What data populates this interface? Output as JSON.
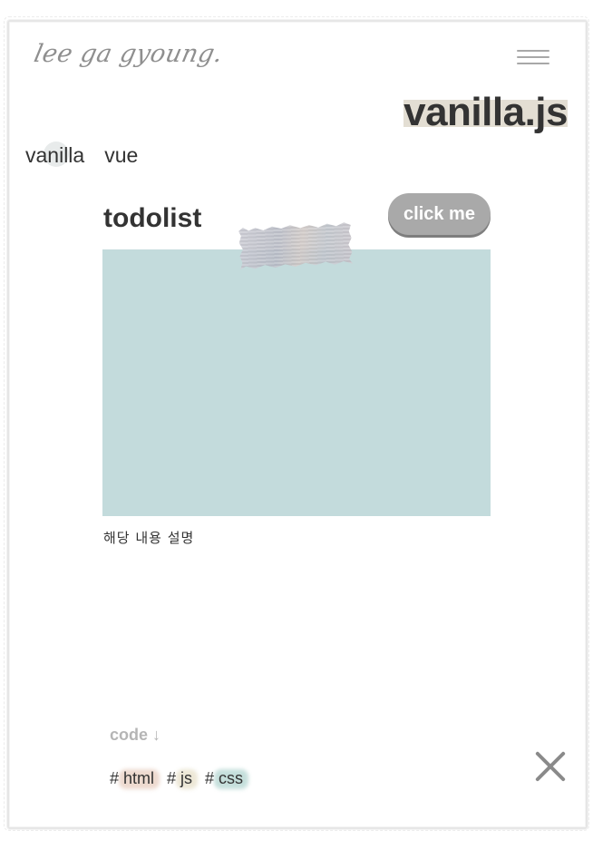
{
  "header": {
    "logo_text": "lee ga gyoung.",
    "menu_icon": "hamburger-menu-icon"
  },
  "page": {
    "title": "vanilla.js",
    "title_highlight_color": "#e3ded3"
  },
  "tabs": [
    {
      "label": "vanilla",
      "active": true
    },
    {
      "label": "vue",
      "active": false
    }
  ],
  "project": {
    "title": "todolist",
    "button_label": "click me",
    "preview_color": "#c3dbdc",
    "description": "해당 내용 설명",
    "code_link": "code ↓",
    "tags": [
      {
        "label": "# html",
        "color": "#ecd6ca"
      },
      {
        "label": "# js",
        "color": "#ebe5d2"
      },
      {
        "label": "# css",
        "color": "#bfdcd8"
      }
    ]
  },
  "controls": {
    "close_icon": "close-icon"
  }
}
